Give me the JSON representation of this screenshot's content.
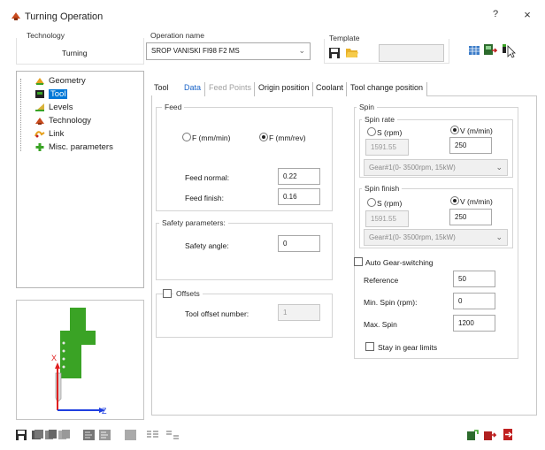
{
  "window": {
    "title": "Turning Operation",
    "help": "?",
    "close": "×"
  },
  "header": {
    "technology_label": "Technology",
    "technology_value": "Turning",
    "operation_name_label": "Operation name",
    "operation_name_value": "SROP VANISKI FI98 F2 MS",
    "template_label": "Template",
    "template_value": ""
  },
  "tree": {
    "items": [
      {
        "label": "Geometry",
        "icon": "geometry-icon"
      },
      {
        "label": "Tool",
        "icon": "tool-icon",
        "selected": true
      },
      {
        "label": "Levels",
        "icon": "levels-icon"
      },
      {
        "label": "Technology",
        "icon": "technology-icon"
      },
      {
        "label": "Link",
        "icon": "link-icon"
      },
      {
        "label": "Misc. parameters",
        "icon": "misc-parameters-icon"
      }
    ]
  },
  "preview": {
    "x_axis": "Z",
    "y_axis": "X"
  },
  "tabs": [
    {
      "label": "Tool",
      "state": "normal"
    },
    {
      "label": "Data",
      "state": "active"
    },
    {
      "label": "Feed Points",
      "state": "disabled"
    },
    {
      "label": "Origin position",
      "state": "normal"
    },
    {
      "label": "Coolant",
      "state": "normal"
    },
    {
      "label": "Tool change position",
      "state": "normal"
    }
  ],
  "feed": {
    "title": "Feed",
    "radio_f_mm_min": "F (mm/min)",
    "radio_f_mm_rev": "F (mm/rev)",
    "selected": "mm/rev",
    "feed_normal_label": "Feed normal:",
    "feed_normal_value": "0.22",
    "feed_finish_label": "Feed finish:",
    "feed_finish_value": "0.16"
  },
  "safety": {
    "title": "Safety parameters:",
    "angle_label": "Safety angle:",
    "angle_value": "0"
  },
  "offsets": {
    "title": "Offsets",
    "checked": false,
    "number_label": "Tool offset number:",
    "number_value": "1"
  },
  "spin": {
    "title": "Spin",
    "rate": {
      "title": "Spin rate",
      "s_label": "S (rpm)",
      "v_label": "V (m/min)",
      "s_value": "1591.55",
      "v_value": "250",
      "selected": "V",
      "gear": "Gear#1(0- 3500rpm, 15kW)"
    },
    "finish": {
      "title": "Spin finish",
      "s_label": "S (rpm)",
      "v_label": "V (m/min)",
      "s_value": "1591.55",
      "v_value": "250",
      "selected": "V",
      "gear": "Gear#1(0- 3500rpm, 15kW)"
    },
    "auto_gear_label": "Auto Gear-switching",
    "auto_gear_checked": false,
    "reference_label": "Reference",
    "reference_value": "50",
    "min_spin_label": "Min. Spin (rpm):",
    "min_spin_value": "0",
    "max_spin_label": "Max. Spin",
    "max_spin_value": "1200",
    "stay_in_gear_label": "Stay in gear limits",
    "stay_in_gear_checked": false
  },
  "colors": {
    "accent": "#0078d7",
    "tab_active": "#1a64c8",
    "tool_green": "#3aa325",
    "axis_red": "#e02020",
    "axis_blue": "#1f3fe0"
  }
}
